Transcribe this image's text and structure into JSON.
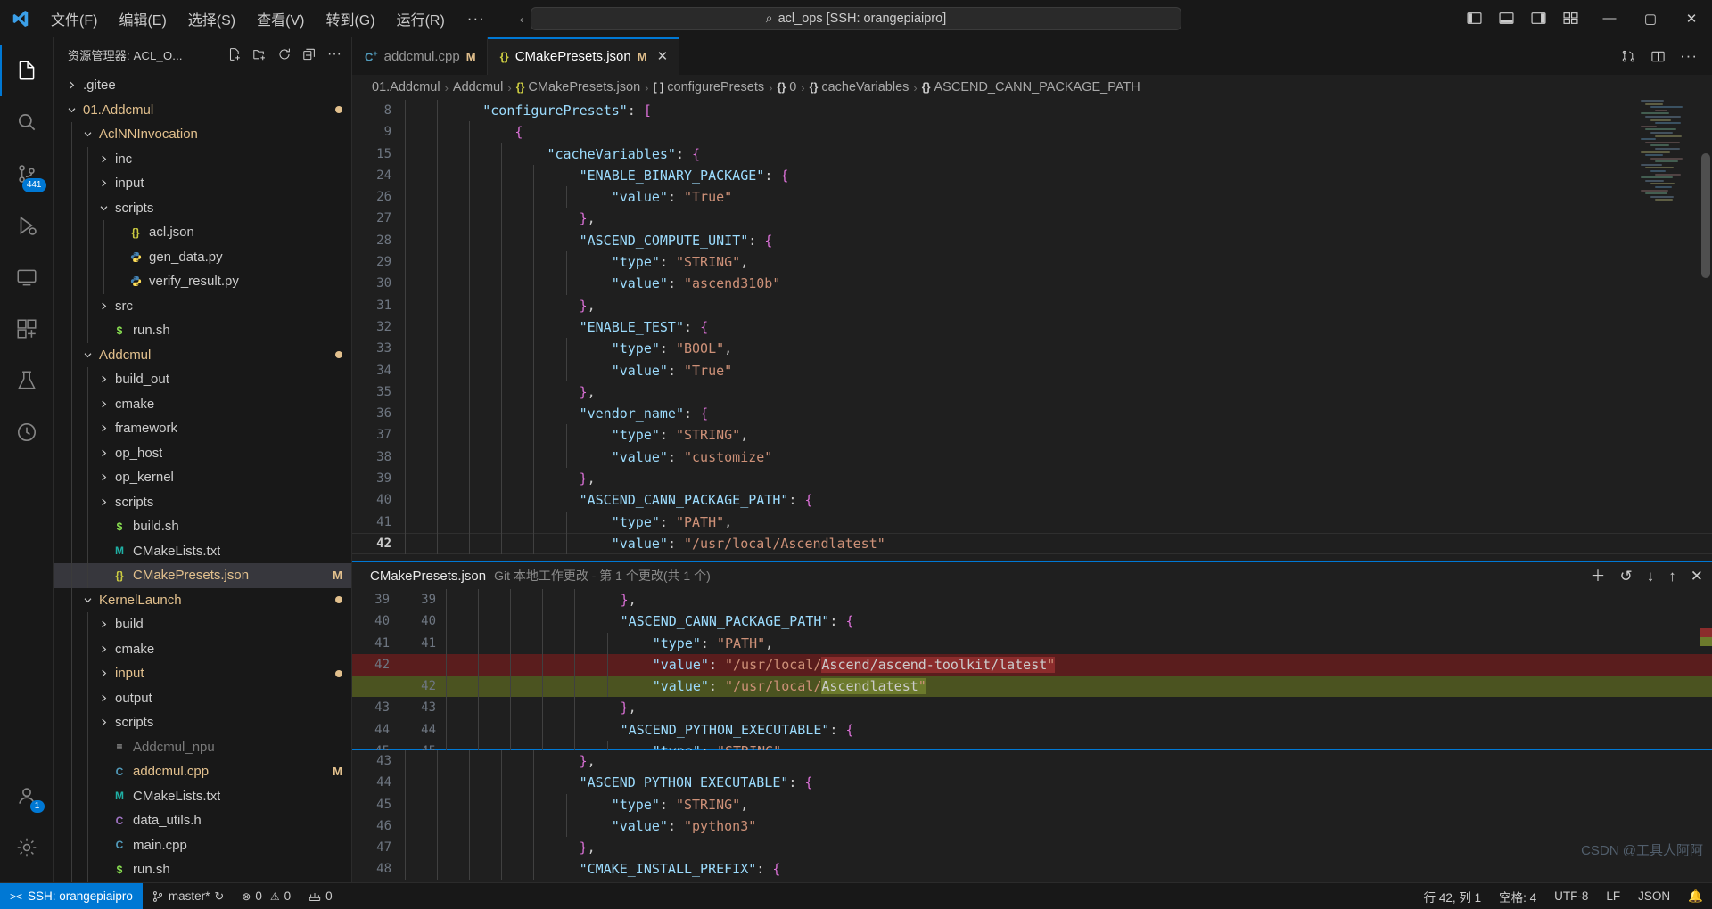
{
  "titlebar": {
    "logo_icon": "vscode-logo-icon",
    "menus": [
      {
        "label": "文件(F)"
      },
      {
        "label": "编辑(E)"
      },
      {
        "label": "选择(S)"
      },
      {
        "label": "查看(V)"
      },
      {
        "label": "转到(G)"
      },
      {
        "label": "运行(R)"
      }
    ],
    "more_label": "···",
    "back_icon": "arrow-left-icon",
    "forward_icon": "arrow-right-icon",
    "search": {
      "icon": "search-icon",
      "value": "acl_ops [SSH: orangepiaipro]"
    },
    "layout_icons": [
      "toggle-primary-sidebar-icon",
      "toggle-panel-icon",
      "toggle-secondary-sidebar-icon",
      "customize-layout-icon"
    ],
    "window_controls": {
      "minimize": "—",
      "maximize": "▢",
      "close": "✕"
    }
  },
  "activitybar": {
    "items": [
      {
        "name": "explorer",
        "icon": "files-icon",
        "active": true,
        "badge": null
      },
      {
        "name": "search",
        "icon": "search-icon",
        "active": false,
        "badge": null
      },
      {
        "name": "source-control",
        "icon": "source-control-icon",
        "active": false,
        "badge": "441"
      },
      {
        "name": "run-and-debug",
        "icon": "debug-icon",
        "active": false,
        "badge": null
      },
      {
        "name": "remote-explorer",
        "icon": "remote-explorer-icon",
        "active": false,
        "badge": null
      },
      {
        "name": "extensions",
        "icon": "extensions-icon",
        "active": false,
        "badge": null
      },
      {
        "name": "testing",
        "icon": "beaker-icon",
        "active": false,
        "badge": null
      },
      {
        "name": "timeline",
        "icon": "history-icon",
        "active": false,
        "badge": null
      }
    ],
    "bottom": [
      {
        "name": "accounts",
        "icon": "account-icon",
        "badge": "1"
      },
      {
        "name": "manage",
        "icon": "gear-icon",
        "badge": null
      }
    ]
  },
  "sidebar": {
    "title": "资源管理器: ACL_O...",
    "actions": [
      "new-file-icon",
      "new-folder-icon",
      "refresh-icon",
      "collapse-all-icon",
      "more-actions-icon"
    ],
    "tree": [
      {
        "indent": 0,
        "chevron": "right",
        "icon": null,
        "label": ".gitee",
        "kind": "folder",
        "badge": null,
        "dot": false
      },
      {
        "indent": 0,
        "chevron": "down",
        "icon": null,
        "label": "01.Addcmul",
        "kind": "folder-mod",
        "badge": null,
        "dot": true
      },
      {
        "indent": 1,
        "chevron": "down",
        "icon": null,
        "label": "AclNNInvocation",
        "kind": "folder-mod",
        "badge": null,
        "dot": false
      },
      {
        "indent": 2,
        "chevron": "right",
        "icon": null,
        "label": "inc",
        "kind": "folder",
        "badge": null,
        "dot": false
      },
      {
        "indent": 2,
        "chevron": "right",
        "icon": null,
        "label": "input",
        "kind": "folder",
        "badge": null,
        "dot": false
      },
      {
        "indent": 2,
        "chevron": "down",
        "icon": null,
        "label": "scripts",
        "kind": "folder",
        "badge": null,
        "dot": false
      },
      {
        "indent": 3,
        "chevron": "none",
        "icon": "json",
        "label": "acl.json",
        "kind": "file",
        "badge": null,
        "dot": false
      },
      {
        "indent": 3,
        "chevron": "none",
        "icon": "py",
        "label": "gen_data.py",
        "kind": "file",
        "badge": null,
        "dot": false
      },
      {
        "indent": 3,
        "chevron": "none",
        "icon": "py",
        "label": "verify_result.py",
        "kind": "file",
        "badge": null,
        "dot": false
      },
      {
        "indent": 2,
        "chevron": "right",
        "icon": null,
        "label": "src",
        "kind": "folder",
        "badge": null,
        "dot": false
      },
      {
        "indent": 2,
        "chevron": "none",
        "icon": "sh",
        "label": "run.sh",
        "kind": "file",
        "badge": null,
        "dot": false
      },
      {
        "indent": 1,
        "chevron": "down",
        "icon": null,
        "label": "Addcmul",
        "kind": "folder-mod",
        "badge": null,
        "dot": true
      },
      {
        "indent": 2,
        "chevron": "right",
        "icon": null,
        "label": "build_out",
        "kind": "folder",
        "badge": null,
        "dot": false
      },
      {
        "indent": 2,
        "chevron": "right",
        "icon": null,
        "label": "cmake",
        "kind": "folder",
        "badge": null,
        "dot": false
      },
      {
        "indent": 2,
        "chevron": "right",
        "icon": null,
        "label": "framework",
        "kind": "folder",
        "badge": null,
        "dot": false
      },
      {
        "indent": 2,
        "chevron": "right",
        "icon": null,
        "label": "op_host",
        "kind": "folder",
        "badge": null,
        "dot": false
      },
      {
        "indent": 2,
        "chevron": "right",
        "icon": null,
        "label": "op_kernel",
        "kind": "folder",
        "badge": null,
        "dot": false
      },
      {
        "indent": 2,
        "chevron": "right",
        "icon": null,
        "label": "scripts",
        "kind": "folder",
        "badge": null,
        "dot": false
      },
      {
        "indent": 2,
        "chevron": "none",
        "icon": "sh",
        "label": "build.sh",
        "kind": "file",
        "badge": null,
        "dot": false
      },
      {
        "indent": 2,
        "chevron": "none",
        "icon": "cmake",
        "label": "CMakeLists.txt",
        "kind": "file",
        "badge": null,
        "dot": false
      },
      {
        "indent": 2,
        "chevron": "none",
        "icon": "json",
        "label": "CMakePresets.json",
        "kind": "file-mod",
        "badge": "M",
        "dot": false,
        "selected": true
      },
      {
        "indent": 1,
        "chevron": "down",
        "icon": null,
        "label": "KernelLaunch",
        "kind": "folder-mod",
        "badge": null,
        "dot": true
      },
      {
        "indent": 2,
        "chevron": "right",
        "icon": null,
        "label": "build",
        "kind": "folder",
        "badge": null,
        "dot": false
      },
      {
        "indent": 2,
        "chevron": "right",
        "icon": null,
        "label": "cmake",
        "kind": "folder",
        "badge": null,
        "dot": false
      },
      {
        "indent": 2,
        "chevron": "right",
        "icon": null,
        "label": "input",
        "kind": "folder-mod",
        "badge": null,
        "dot": true
      },
      {
        "indent": 2,
        "chevron": "right",
        "icon": null,
        "label": "output",
        "kind": "folder",
        "badge": null,
        "dot": false
      },
      {
        "indent": 2,
        "chevron": "right",
        "icon": null,
        "label": "scripts",
        "kind": "folder",
        "badge": null,
        "dot": false
      },
      {
        "indent": 2,
        "chevron": "none",
        "icon": "txt",
        "label": "Addcmul_npu",
        "kind": "file-dim",
        "badge": null,
        "dot": false
      },
      {
        "indent": 2,
        "chevron": "none",
        "icon": "cpp",
        "label": "addcmul.cpp",
        "kind": "file-mod",
        "badge": "M",
        "dot": false
      },
      {
        "indent": 2,
        "chevron": "none",
        "icon": "cmake",
        "label": "CMakeLists.txt",
        "kind": "file",
        "badge": null,
        "dot": false
      },
      {
        "indent": 2,
        "chevron": "none",
        "icon": "h",
        "label": "data_utils.h",
        "kind": "file",
        "badge": null,
        "dot": false
      },
      {
        "indent": 2,
        "chevron": "none",
        "icon": "cpp",
        "label": "main.cpp",
        "kind": "file",
        "badge": null,
        "dot": false
      },
      {
        "indent": 2,
        "chevron": "none",
        "icon": "sh",
        "label": "run.sh",
        "kind": "file",
        "badge": null,
        "dot": false
      }
    ]
  },
  "editor": {
    "tabs": [
      {
        "icon": "cpp",
        "label": "addcmul.cpp",
        "modified": "M",
        "active": false,
        "closable": false
      },
      {
        "icon": "json",
        "label": "CMakePresets.json",
        "modified": "M",
        "active": true,
        "closable": true
      }
    ],
    "tab_actions": [
      "split-editor-icon",
      "open-changes-icon",
      "more-actions-icon"
    ],
    "breadcrumb": [
      {
        "icon": null,
        "label": "01.Addcmul"
      },
      {
        "icon": null,
        "label": "Addcmul"
      },
      {
        "icon": "json",
        "label": "CMakePresets.json"
      },
      {
        "icon": "arr",
        "label": "configurePresets"
      },
      {
        "icon": "obj",
        "label": "0"
      },
      {
        "icon": "obj",
        "label": "cacheVariables"
      },
      {
        "icon": "obj",
        "label": "ASCEND_CANN_PACKAGE_PATH"
      }
    ],
    "top_lines": [
      {
        "n": "8",
        "indent": 2,
        "text": "\"configurePresets\": [",
        "type": "key-open-arr"
      },
      {
        "n": "9",
        "indent": 3,
        "text": "{",
        "type": "brace"
      },
      {
        "n": "15",
        "indent": 4,
        "text": "\"cacheVariables\": {",
        "type": "key-open"
      },
      {
        "n": "24",
        "indent": 5,
        "text": "\"ENABLE_BINARY_PACKAGE\": {",
        "type": "key-open"
      },
      {
        "n": "26",
        "indent": 6,
        "text": "\"value\": \"True\"",
        "type": "key-val"
      },
      {
        "n": "27",
        "indent": 5,
        "text": "},",
        "type": "brace"
      },
      {
        "n": "28",
        "indent": 5,
        "text": "\"ASCEND_COMPUTE_UNIT\": {",
        "type": "key-open"
      },
      {
        "n": "29",
        "indent": 6,
        "text": "\"type\": \"STRING\",",
        "type": "key-val"
      },
      {
        "n": "30",
        "indent": 6,
        "text": "\"value\": \"ascend310b\"",
        "type": "key-val"
      },
      {
        "n": "31",
        "indent": 5,
        "text": "},",
        "type": "brace"
      },
      {
        "n": "32",
        "indent": 5,
        "text": "\"ENABLE_TEST\": {",
        "type": "key-open"
      },
      {
        "n": "33",
        "indent": 6,
        "text": "\"type\": \"BOOL\",",
        "type": "key-val"
      },
      {
        "n": "34",
        "indent": 6,
        "text": "\"value\": \"True\"",
        "type": "key-val"
      },
      {
        "n": "35",
        "indent": 5,
        "text": "},",
        "type": "brace"
      },
      {
        "n": "36",
        "indent": 5,
        "text": "\"vendor_name\": {",
        "type": "key-open"
      },
      {
        "n": "37",
        "indent": 6,
        "text": "\"type\": \"STRING\",",
        "type": "key-val"
      },
      {
        "n": "38",
        "indent": 6,
        "text": "\"value\": \"customize\"",
        "type": "key-val"
      },
      {
        "n": "39",
        "indent": 5,
        "text": "},",
        "type": "brace"
      },
      {
        "n": "40",
        "indent": 5,
        "text": "\"ASCEND_CANN_PACKAGE_PATH\": {",
        "type": "key-open-boxed"
      },
      {
        "n": "41",
        "indent": 6,
        "text": "\"type\": \"PATH\",",
        "type": "key-val"
      },
      {
        "n": "42",
        "indent": 6,
        "text": "\"value\": \"/usr/local/Ascendlatest\"",
        "type": "key-val",
        "current": true
      }
    ],
    "bottom_lines": [
      {
        "n": "43",
        "indent": 5,
        "text": "},",
        "type": "brace-boxed"
      },
      {
        "n": "44",
        "indent": 5,
        "text": "\"ASCEND_PYTHON_EXECUTABLE\": {",
        "type": "key-open"
      },
      {
        "n": "45",
        "indent": 6,
        "text": "\"type\": \"STRING\",",
        "type": "key-val"
      },
      {
        "n": "46",
        "indent": 6,
        "text": "\"value\": \"python3\"",
        "type": "key-val"
      },
      {
        "n": "47",
        "indent": 5,
        "text": "},",
        "type": "brace"
      },
      {
        "n": "48",
        "indent": 5,
        "text": "\"CMAKE_INSTALL_PREFIX\": {",
        "type": "key-open"
      }
    ]
  },
  "diff": {
    "title": "CMakePresets.json",
    "subtitle": "Git 本地工作更改 - 第 1 个更改(共 1 个)",
    "actions": [
      "add-icon",
      "revert-icon",
      "next-change-icon",
      "previous-change-icon",
      "close-icon"
    ],
    "lines": [
      {
        "old": "39",
        "new": "39",
        "indent": 5,
        "text": "},",
        "state": "same"
      },
      {
        "old": "40",
        "new": "40",
        "indent": 5,
        "text": "\"ASCEND_CANN_PACKAGE_PATH\": {",
        "state": "same"
      },
      {
        "old": "41",
        "new": "41",
        "indent": 6,
        "text": "\"type\": \"PATH\",",
        "state": "same"
      },
      {
        "old": "42",
        "new": "",
        "indent": 6,
        "text": "\"value\": \"/usr/local/Ascend/ascend-toolkit/latest\"",
        "state": "deleted",
        "highlight_from": "Ascend/ascend-toolkit/latest\""
      },
      {
        "old": "",
        "new": "42",
        "indent": 6,
        "text": "\"value\": \"/usr/local/Ascendlatest\"",
        "state": "inserted",
        "highlight_from": "Ascendlatest\""
      },
      {
        "old": "43",
        "new": "43",
        "indent": 5,
        "text": "},",
        "state": "same"
      },
      {
        "old": "44",
        "new": "44",
        "indent": 5,
        "text": "\"ASCEND_PYTHON_EXECUTABLE\": {",
        "state": "same"
      },
      {
        "old": "45",
        "new": "45",
        "indent": 6,
        "text": "\"type\": \"STRING\",",
        "state": "same"
      }
    ]
  },
  "statusbar": {
    "remote": {
      "icon": "remote-indicator-icon",
      "label": "SSH: orangepiaipro"
    },
    "branch": {
      "icon": "source-control-icon",
      "label": "master*",
      "sync_icon": "sync-icon"
    },
    "problems": {
      "error_icon": "error-icon",
      "errors": "0",
      "warning_icon": "warning-icon",
      "warnings": "0"
    },
    "ports": {
      "icon": "ports-icon",
      "count": "0"
    },
    "right": [
      {
        "name": "cursor-position",
        "label": "行 42, 列 1"
      },
      {
        "name": "indentation",
        "label": "空格: 4"
      },
      {
        "name": "encoding",
        "label": "UTF-8"
      },
      {
        "name": "eol",
        "label": "LF"
      },
      {
        "name": "language-mode",
        "label": "JSON"
      },
      {
        "name": "notifications",
        "label": "🔔"
      }
    ]
  },
  "watermark": "CSDN @工具人阿阿"
}
